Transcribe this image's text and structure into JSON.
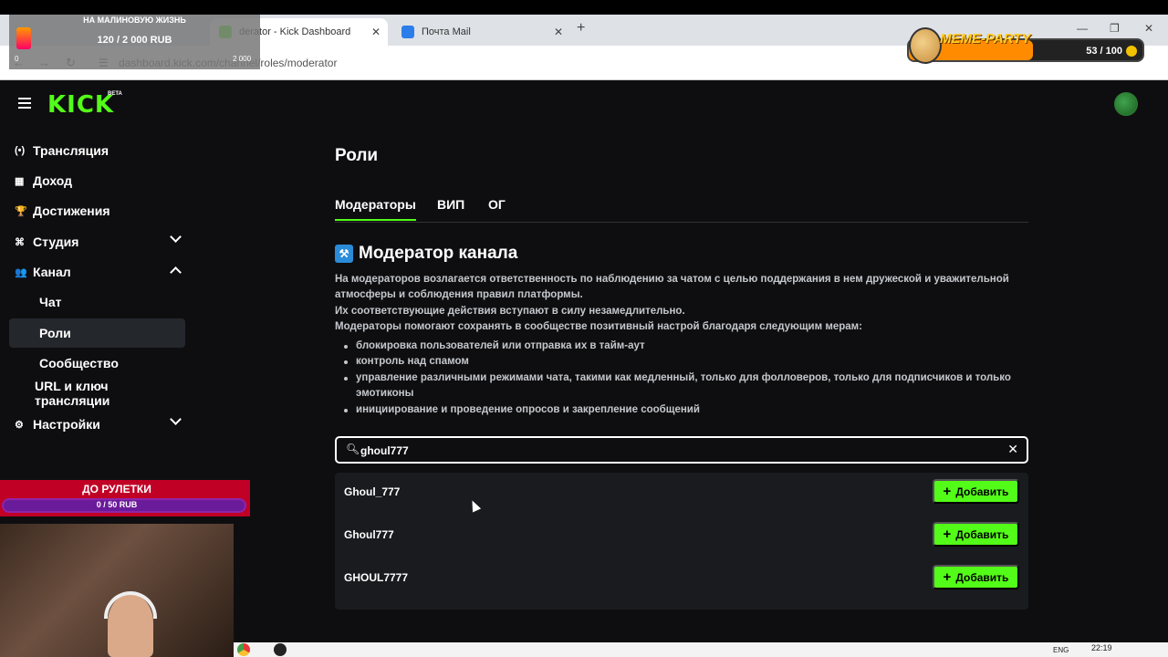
{
  "browser": {
    "tabs": [
      {
        "label": "derator - Kick Dashboard"
      },
      {
        "label": "Почта Mail"
      }
    ],
    "url": "dashboard.kick.com/channel/roles/moderator"
  },
  "overlays": {
    "donate_title": "НА МАЛИНОВУЮ ЖИЗНЬ",
    "donate_progress": "120 / 2 000 RUB",
    "donate_min": "0",
    "donate_max": "2 000",
    "meme_party_label": "MEME-PARTY",
    "meme_party_count": "53 / 100",
    "roulette_title": "ДО РУЛЕТКИ",
    "roulette_progress": "0 / 50 RUB"
  },
  "header": {
    "logo": "KICK",
    "logo_badge": "BETA"
  },
  "sidebar": {
    "items": [
      {
        "label": "Трансляция",
        "icon": "broadcast-icon",
        "glyph": "(•)"
      },
      {
        "label": "Доход",
        "icon": "revenue-icon",
        "glyph": "▦"
      },
      {
        "label": "Достижения",
        "icon": "trophy-icon",
        "glyph": "🏆"
      },
      {
        "label": "Студия",
        "icon": "studio-icon",
        "glyph": "⌘"
      },
      {
        "label": "Канал",
        "icon": "channel-icon",
        "glyph": "👥"
      },
      {
        "label": "Настройки",
        "icon": "gear-icon",
        "glyph": "⚙"
      }
    ],
    "sub_items": [
      {
        "label": "Чат"
      },
      {
        "label": "Роли"
      },
      {
        "label": "Сообщество"
      },
      {
        "label": "URL и ключ трансляции"
      }
    ]
  },
  "main": {
    "title": "Роли",
    "tabs": [
      {
        "label": "Модераторы"
      },
      {
        "label": "ВИП"
      },
      {
        "label": "ОГ"
      }
    ],
    "section_title": "Модератор канала",
    "description": [
      "На модераторов возлагается ответственность по наблюдению за чатом с целью поддержания в нем дружеской и уважительной атмосферы и соблюдения правил платформы.",
      "Их соответствующие действия вступают в силу незамедлительно.",
      "Модераторы помогают сохранять в сообществе позитивный настрой благодаря следующим мерам:"
    ],
    "bullets": [
      "блокировка пользователей или отправка их в тайм-аут",
      "контроль над спамом",
      "управление различными режимами чата, такими как медленный, только для фолловеров, только для подписчиков и только эмотиконы",
      "инициирование и проведение опросов и закрепление сообщений"
    ],
    "search": {
      "value": "ghoul777",
      "placeholder": ""
    },
    "results": [
      {
        "name": "Ghoul_777",
        "button": "Добавить"
      },
      {
        "name": "Ghoul777",
        "button": "Добавить"
      },
      {
        "name": "GHOUL7777",
        "button": "Добавить"
      }
    ]
  },
  "taskbar": {
    "lang": "ENG",
    "time": "22:19"
  },
  "colors": {
    "accent": "#53fc18",
    "background": "#0e0e10",
    "panel": "#191b1f"
  }
}
